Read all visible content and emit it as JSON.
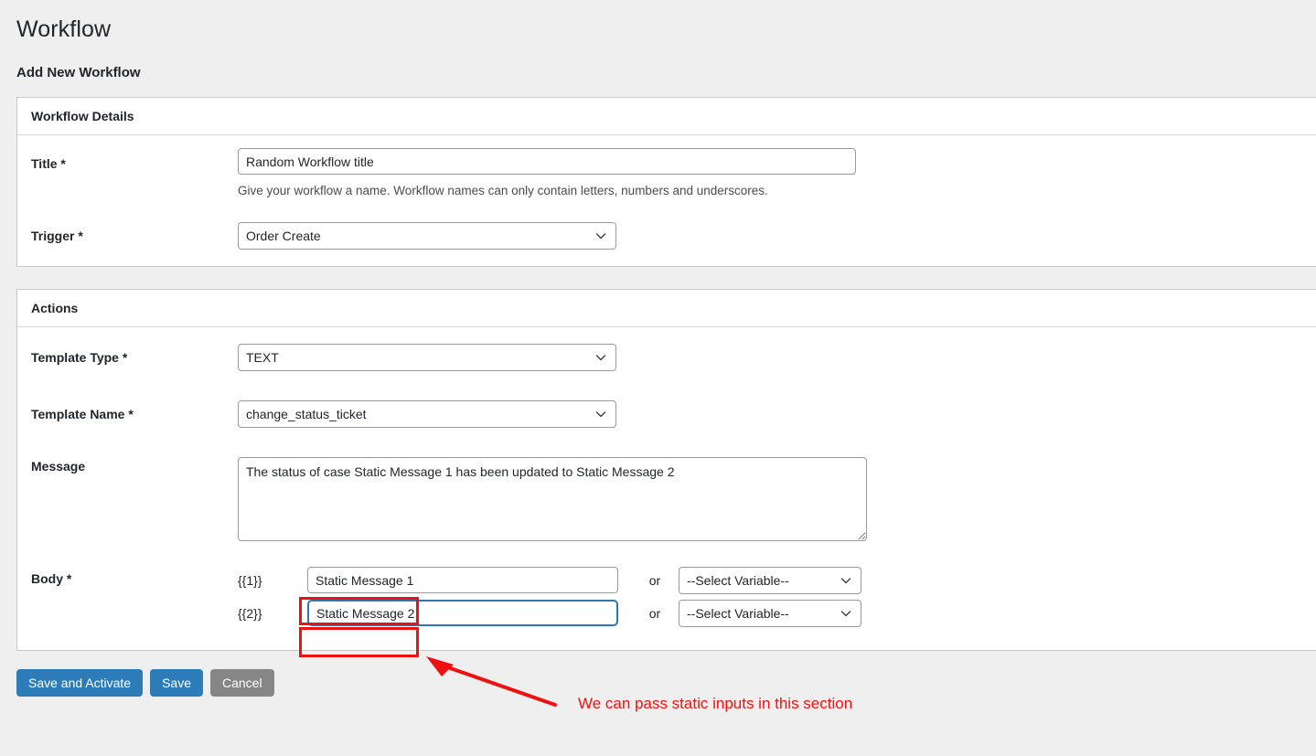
{
  "page": {
    "title": "Workflow",
    "subtitle": "Add New Workflow"
  },
  "workflow_details": {
    "header": "Workflow Details",
    "title_label": "Title *",
    "title_value": "Random Workflow title",
    "title_placeholder": "",
    "title_help": "Give your workflow a name. Workflow names can only contain letters, numbers and underscores.",
    "trigger_label": "Trigger *",
    "trigger_value": "Order Create",
    "trigger_options": [
      "Order Create"
    ]
  },
  "actions": {
    "header": "Actions",
    "template_type_label": "Template Type *",
    "template_type_value": "TEXT",
    "template_type_options": [
      "TEXT"
    ],
    "template_name_label": "Template Name *",
    "template_name_value": "change_status_ticket",
    "template_name_options": [
      "change_status_ticket"
    ],
    "message_label": "Message",
    "message_value": "The status of case Static Message 1 has been updated to Static Message 2",
    "body_label": "Body *",
    "or_label": "or",
    "body_rows": [
      {
        "token": "{{1}}",
        "input_value": "Static Message 1",
        "select_value": "--Select Variable--",
        "select_options": [
          "--Select Variable--"
        ]
      },
      {
        "token": "{{2}}",
        "input_value": "Static Message 2",
        "select_value": "--Select Variable--",
        "select_options": [
          "--Select Variable--"
        ]
      }
    ]
  },
  "footer": {
    "save_and_activate_label": "Save and Activate",
    "save_label": "Save",
    "cancel_label": "Cancel"
  },
  "annotation": {
    "text": "We can pass static inputs in this section",
    "color": "#fb0d0d"
  },
  "colors": {
    "primary_button": "#2b7cb8",
    "secondary_button": "#868686",
    "focus_border": "#2979b8",
    "page_background": "#efefef",
    "annotation_red": "#ee1111"
  }
}
